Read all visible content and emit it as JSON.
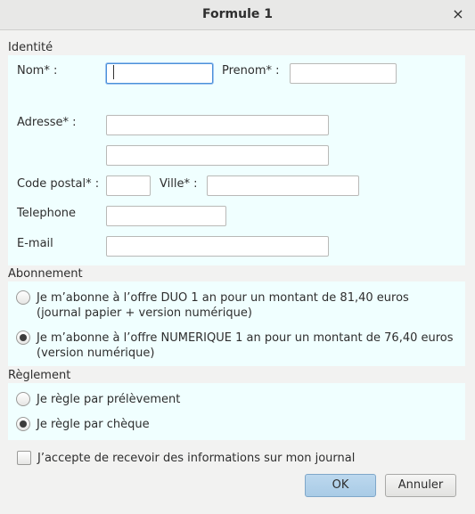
{
  "window": {
    "title": "Formule 1",
    "close_label": "×"
  },
  "identite": {
    "section_title": "Identité",
    "nom_label": "Nom* :",
    "prenom_label": "Prenom* :",
    "adresse_label": "Adresse* :",
    "code_postal_label": "Code postal* :",
    "ville_label": "Ville* :",
    "telephone_label": "Telephone",
    "email_label": "E-mail",
    "nom_value": "",
    "prenom_value": "",
    "adresse1_value": "",
    "adresse2_value": "",
    "code_postal_value": "",
    "ville_value": "",
    "telephone_value": "",
    "email_value": ""
  },
  "abonnement": {
    "section_title": "Abonnement",
    "options": [
      {
        "line1": "Je m’abonne à l’offre DUO 1 an pour un montant de 81,40 euros",
        "line2": "(journal papier + version numérique)",
        "checked": false
      },
      {
        "line1": "Je m’abonne à l’offre NUMERIQUE 1 an pour un montant de 76,40 euros",
        "line2": "(version numérique)",
        "checked": true
      }
    ]
  },
  "reglement": {
    "section_title": "Règlement",
    "options": [
      {
        "label": "Je règle par prélèvement",
        "checked": false
      },
      {
        "label": "Je règle par chèque",
        "checked": true
      }
    ]
  },
  "consent": {
    "label": "J’accepte de recevoir des informations sur mon journal",
    "checked": false
  },
  "buttons": {
    "ok": "OK",
    "cancel": "Annuler"
  }
}
